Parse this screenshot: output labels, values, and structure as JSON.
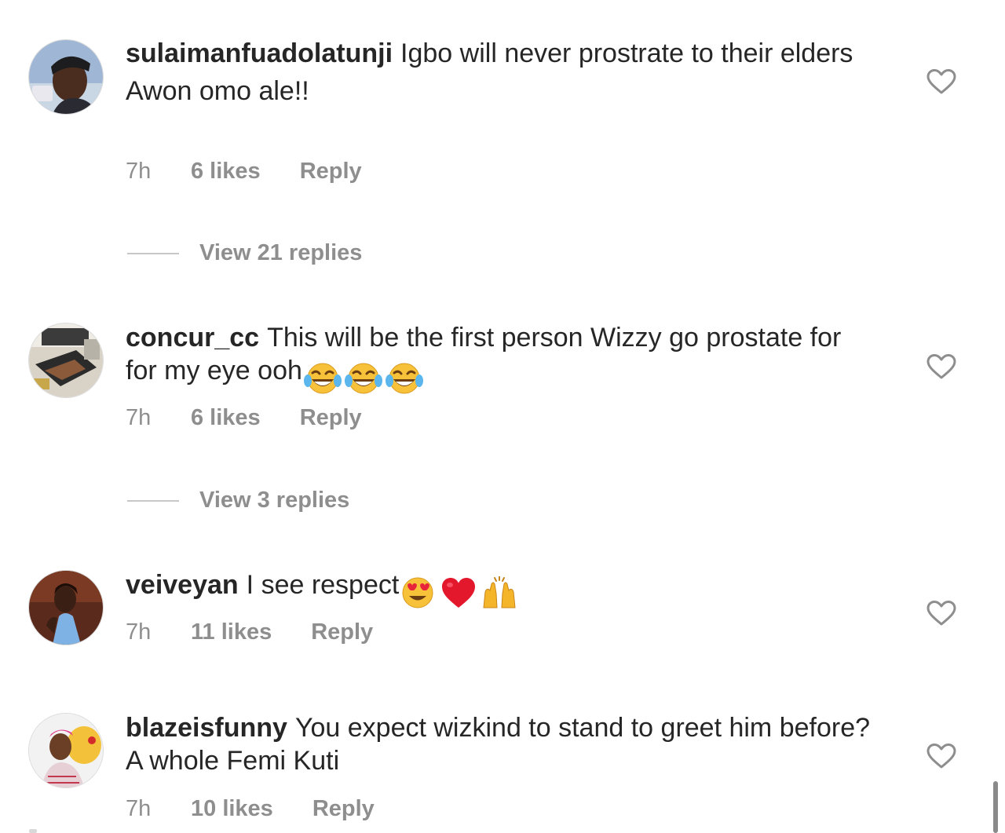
{
  "comments": [
    {
      "username": "sulaimanfuadolatunji",
      "text": "Igbo will never prostrate to their elders",
      "text_line2": "Awon omo ale!!",
      "time": "7h",
      "likes": "6 likes",
      "reply": "Reply",
      "view_replies": "View 21 replies"
    },
    {
      "username": "concur_cc",
      "text": "This will be the first person Wizzy go prostate for for my eye ooh",
      "emojis": [
        "face-with-tears-of-joy-icon",
        "face-with-tears-of-joy-icon",
        "face-with-tears-of-joy-icon"
      ],
      "time": "7h",
      "likes": "6 likes",
      "reply": "Reply",
      "view_replies": "View 3 replies"
    },
    {
      "username": "veiveyan",
      "text": "I see respect",
      "emojis": [
        "heart-eyes-icon",
        "red-heart-icon",
        "raising-hands-icon"
      ],
      "time": "7h",
      "likes": "11 likes",
      "reply": "Reply"
    },
    {
      "username": "blazeisfunny",
      "text": "You expect wizkind to stand to greet him before? A whole Femi Kuti",
      "time": "7h",
      "likes": "10 likes",
      "reply": "Reply"
    }
  ],
  "colors": {
    "text": "#262626",
    "secondary": "#8e8e8e",
    "divider": "#c7c7c7",
    "heart_outline": "#8e8e8e"
  }
}
